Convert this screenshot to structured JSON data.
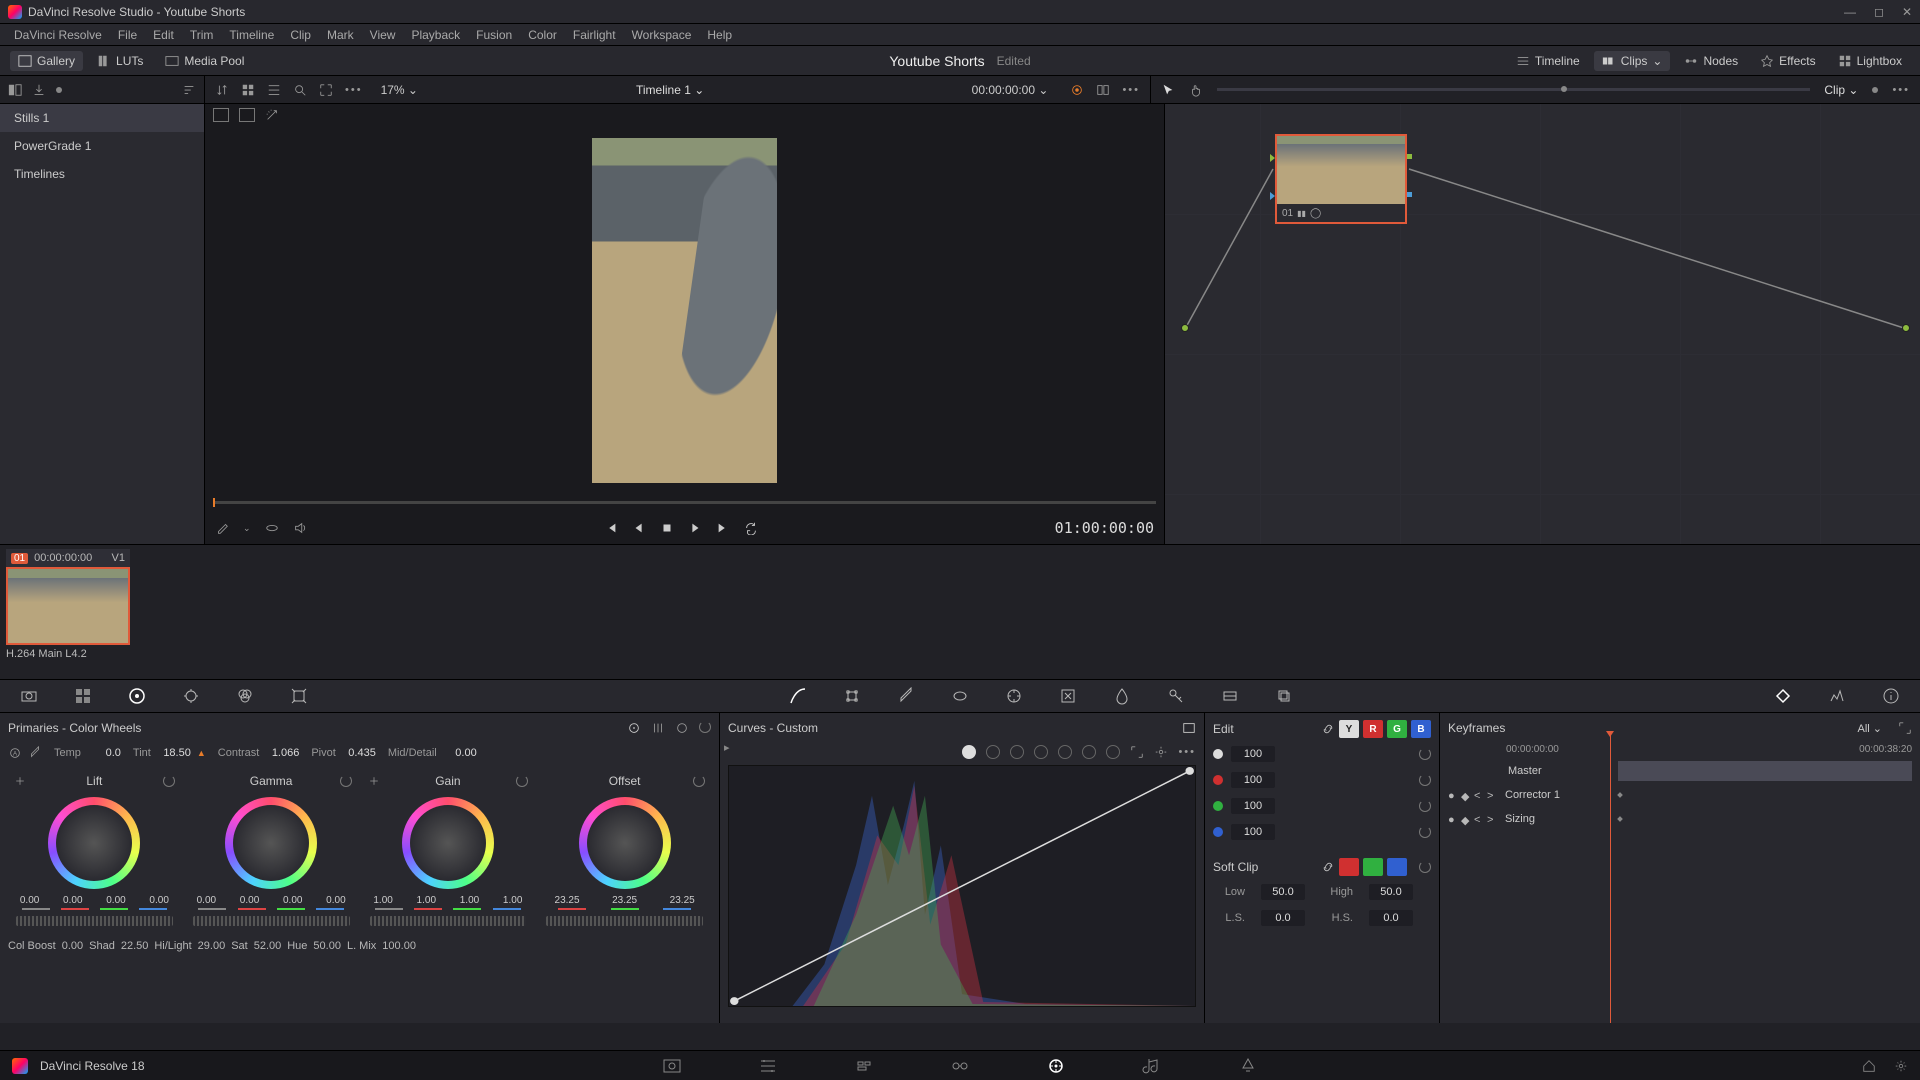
{
  "titlebar": {
    "text": "DaVinci Resolve Studio - Youtube Shorts"
  },
  "menubar": [
    "DaVinci Resolve",
    "File",
    "Edit",
    "Trim",
    "Timeline",
    "Clip",
    "Mark",
    "View",
    "Playback",
    "Fusion",
    "Color",
    "Fairlight",
    "Workspace",
    "Help"
  ],
  "toptool": {
    "gallery": "Gallery",
    "luts": "LUTs",
    "mediapool": "Media Pool",
    "project": "Youtube Shorts",
    "edited": "Edited",
    "timeline": "Timeline",
    "clips": "Clips",
    "nodes": "Nodes",
    "effects": "Effects",
    "lightbox": "Lightbox"
  },
  "secbar": {
    "zoom": "17%",
    "timeline": "Timeline 1",
    "timecode": "00:00:00:00",
    "clip": "Clip"
  },
  "sidebar": {
    "items": [
      "Stills 1",
      "PowerGrade 1",
      "Timelines"
    ]
  },
  "viewer": {
    "tc": "01:00:00:00"
  },
  "nodes": {
    "node_label": "01"
  },
  "clipstrip": {
    "num": "01",
    "tc": "00:00:00:00",
    "track": "V1",
    "codec": "H.264 Main L4.2"
  },
  "primaries": {
    "title": "Primaries - Color Wheels",
    "temp_lbl": "Temp",
    "temp": "0.0",
    "tint_lbl": "Tint",
    "tint": "18.50",
    "contrast_lbl": "Contrast",
    "contrast": "1.066",
    "pivot_lbl": "Pivot",
    "pivot": "0.435",
    "md_lbl": "Mid/Detail",
    "md": "0.00",
    "wheels": [
      {
        "name": "Lift",
        "vals": [
          "0.00",
          "0.00",
          "0.00",
          "0.00"
        ]
      },
      {
        "name": "Gamma",
        "vals": [
          "0.00",
          "0.00",
          "0.00",
          "0.00"
        ]
      },
      {
        "name": "Gain",
        "vals": [
          "1.00",
          "1.00",
          "1.00",
          "1.00"
        ]
      },
      {
        "name": "Offset",
        "vals": [
          "23.25",
          "23.25",
          "23.25"
        ]
      }
    ],
    "bottom": {
      "colboost_lbl": "Col Boost",
      "colboost": "0.00",
      "shad_lbl": "Shad",
      "shad": "22.50",
      "hilight_lbl": "Hi/Light",
      "hilight": "29.00",
      "sat_lbl": "Sat",
      "sat": "52.00",
      "hue_lbl": "Hue",
      "hue": "50.00",
      "lmix_lbl": "L. Mix",
      "lmix": "100.00"
    }
  },
  "curves": {
    "title": "Curves - Custom"
  },
  "curve_edit": {
    "edit_lbl": "Edit",
    "y_chip": "Y",
    "r_chip": "R",
    "g_chip": "G",
    "b_chip": "B",
    "ch_vals": [
      "100",
      "100",
      "100",
      "100"
    ],
    "soft_lbl": "Soft Clip",
    "low_lbl": "Low",
    "low": "50.0",
    "high_lbl": "High",
    "high": "50.0",
    "ls_lbl": "L.S.",
    "ls": "0.0",
    "hs_lbl": "H.S.",
    "hs": "0.0"
  },
  "keyframes": {
    "title": "Keyframes",
    "all": "All",
    "tc": "00:00:00:00",
    "tc_end": "00:00:38:20",
    "master": "Master",
    "corrector": "Corrector 1",
    "sizing": "Sizing"
  },
  "bottombar": {
    "name": "DaVinci Resolve 18"
  }
}
